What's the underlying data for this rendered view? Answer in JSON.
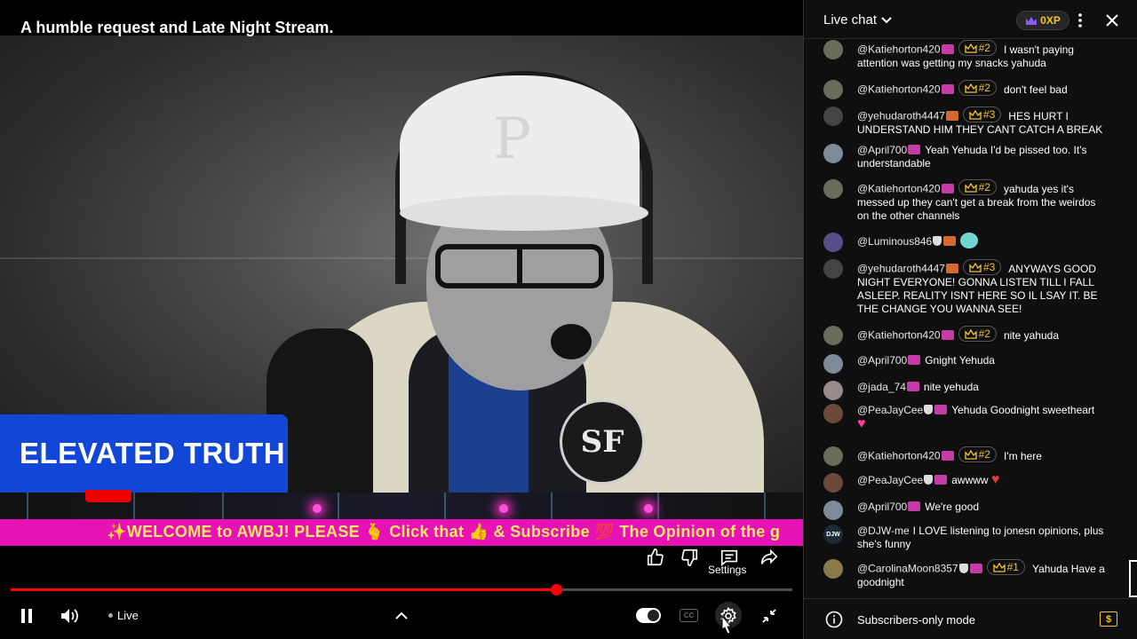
{
  "video": {
    "title": "A humble request and Late Night Stream.",
    "lower_third": "ELEVATED TRUTH",
    "ticker": "✨WELCOME to AWBJ! PLEASE 🫰 Click that 👍 & Subscribe 💯 The Opinion of the g",
    "cap_logo": "P",
    "patch_logo": "SF",
    "settings_label": "Settings",
    "live_label": "Live",
    "cc_label": "CC",
    "progress_fraction": 0.698
  },
  "chat": {
    "title": "Live chat",
    "xp": "0XP",
    "footer_label": "Subscribers-only mode",
    "dollar": "$",
    "messages": [
      {
        "author": "@Katiehorton420",
        "rank": "#2",
        "text": "I wasn't paying attention was getting my snacks yahuda"
      },
      {
        "author": "@Katiehorton420",
        "rank": "#2",
        "text": "don't feel bad"
      },
      {
        "author": "@yehudaroth4447",
        "rank": "#3",
        "text": "HES HURT I UNDERSTAND HIM THEY CANT CATCH A BREAK"
      },
      {
        "author": "@April700",
        "text": "Yeah Yehuda I'd be pissed too. It's understandable"
      },
      {
        "author": "@Katiehorton420",
        "rank": "#2",
        "text": "yahuda yes it's messed up they can't get a break from the weirdos on the other channels"
      },
      {
        "author": "@Luminous846",
        "text": ""
      },
      {
        "author": "@yehudaroth4447",
        "rank": "#3",
        "text": "ANYWAYS GOOD NIGHT EVERYONE! GONNA LISTEN TILL I FALL ASLEEP. REALITY ISNT HERE SO IL LSAY IT. BE THE CHANGE YOU WANNA SEE!"
      },
      {
        "author": "@Katiehorton420",
        "rank": "#2",
        "text": "nite yahuda"
      },
      {
        "author": "@April700",
        "text": "Gnight Yehuda"
      },
      {
        "author": "@jada_74",
        "text": "nite yehuda"
      },
      {
        "author": "@PeaJayCee",
        "text": "Yehuda Goodnight sweetheart"
      },
      {
        "author": "@Katiehorton420",
        "rank": "#2",
        "text": "I'm here"
      },
      {
        "author": "@PeaJayCee",
        "text": "awwww"
      },
      {
        "author": "@April700",
        "text": "We're good"
      },
      {
        "author": "@DJW-me",
        "avatar_text": "DJW",
        "text": "I LOVE listening to jonesn opinions, plus she's funny"
      },
      {
        "author": "@CarolinaMoon8357",
        "rank": "#1",
        "text": "Yahuda Have a goodnight"
      }
    ]
  }
}
